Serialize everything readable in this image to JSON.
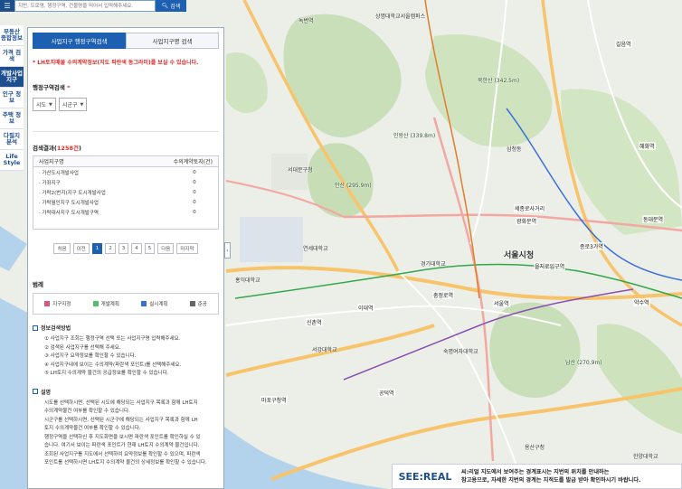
{
  "search": {
    "placeholder": "지번, 도로명, 행정구역, 건물명을 띄어서 입력해주세요.",
    "button_label": "검색"
  },
  "leftnav": {
    "items": [
      {
        "label": "부동산 종합정보",
        "active": false
      },
      {
        "label": "가격 검색",
        "active": false
      },
      {
        "label": "개발사업 지구",
        "active": true
      },
      {
        "label": "인구 정보",
        "active": false
      },
      {
        "label": "주택 정보",
        "active": false
      },
      {
        "label": "다필지 분석",
        "active": false
      },
      {
        "label": "Life Style",
        "active": false
      }
    ]
  },
  "panel": {
    "tabs": [
      {
        "label": "사업지구 행정구역검색",
        "active": true
      },
      {
        "label": "사업지구명 검색",
        "active": false
      }
    ],
    "notice": "* LH토지매물 수의계약정보(지도 파란색 동그라미)를 보실 수 있습니다.",
    "region_title": "행정구역검색",
    "region_required": "*",
    "select_sido": "시도",
    "select_sigungu": "시군구",
    "results_title_prefix": "검색결과(",
    "results_count": "1258건",
    "results_title_suffix": ")",
    "table_headers": {
      "name": "사업지구명",
      "count": "수의계약토지(건)"
    },
    "rows": [
      {
        "name": "· 가산도시개발사업",
        "count": "0"
      },
      {
        "name": "· 가좌지구",
        "count": "0"
      },
      {
        "name": "· 가락2(번지)지구 도시개발사업",
        "count": "0"
      },
      {
        "name": "· 가락월인지구 도시개발사업",
        "count": "0"
      },
      {
        "name": "· 가락대사지구 도시개발구역",
        "count": "0"
      }
    ],
    "pager": {
      "first": "처음",
      "prev": "이전",
      "pages": [
        "1",
        "2",
        "3",
        "4",
        "5"
      ],
      "current": "1",
      "next": "다음",
      "last": "마지막"
    },
    "legend_title": "범례",
    "legend": [
      {
        "label": "지구지정",
        "color": "#e0527f"
      },
      {
        "label": "개발계획",
        "color": "#4fbf6a"
      },
      {
        "label": "실시계획",
        "color": "#3a6fd8"
      },
      {
        "label": "준공",
        "color": "#666666"
      }
    ],
    "guide_title": "정보검색방법",
    "guide_steps": [
      "① 사업지구 조회는 행정구역 선택 또는 사업지구명 입력해주세요.",
      "② 검색된 사업지구를 선택해 주세요.",
      "③ 사업지구 요약정보를 확인할 수 있습니다.",
      "④ 사업지구내에 보이는 수의계약(파란색 포인트)를 선택해주세요.",
      "⑤ LH토지 수의계약 물건의 공급정보를 확인할 수 있습니다."
    ],
    "desc_title": "설명",
    "desc_lines": [
      "시도를 선택하시면, 선택된 시도에 해당되는 사업지구 목록과 함께 LH토지",
      "수의계약물건 여부를 확인할 수 있습니다.",
      "시군구를 선택하시면, 선택된 시군구에 해당되는 사업지구 목록과 함께 LH",
      "토지 수의계약물건 여부를 확인할 수 있습니다.",
      "행정구역을 선택하신 후 지도화면을 보시면 파란색 포인트를 확인하실 수 있",
      "습니다. 여기서 보이는 파란색 포인트가 현재 LH토지 수의계약 물건입니다.",
      "조회된 사업지구를 지도에서 선택하여 요약정보를 확인할 수 있으며, 파란색",
      "포인트를 선택하시면 LH토지 수의계약 물건의 상세정보를 확인할 수 있습니다."
    ]
  },
  "map": {
    "labels": [
      {
        "text": "서울시청",
        "big": true
      },
      {
        "text": "녹번역"
      },
      {
        "text": "상명대학교서울캠퍼스"
      },
      {
        "text": "북한산 (342.5m)"
      },
      {
        "text": "인왕산 (339.8m)"
      },
      {
        "text": "안산 (295.9m)"
      },
      {
        "text": "남산 (270.9m)"
      },
      {
        "text": "서대문구청"
      },
      {
        "text": "연세대학교"
      },
      {
        "text": "서강대학교"
      },
      {
        "text": "홍익대학교"
      },
      {
        "text": "경기대학교"
      },
      {
        "text": "숙명여자대학교"
      },
      {
        "text": "세종로사거리"
      },
      {
        "text": "서울역"
      },
      {
        "text": "충정로역"
      },
      {
        "text": "광화문역"
      },
      {
        "text": "종로3가역"
      },
      {
        "text": "동대문역"
      },
      {
        "text": "을지로입구역"
      },
      {
        "text": "신촌역"
      },
      {
        "text": "이대역"
      },
      {
        "text": "공덕역"
      },
      {
        "text": "마포구청역"
      },
      {
        "text": "삼청동"
      },
      {
        "text": "길음역"
      },
      {
        "text": "혜화역"
      },
      {
        "text": "한양대학교"
      },
      {
        "text": "용산구청"
      },
      {
        "text": "약수역"
      }
    ]
  },
  "banner": {
    "logo": "SEE:REAL",
    "line1": "씨:리얼 지도에서 보여주는 경계표시는 지번의 위치를 안내하는",
    "line2": "참고용으로, 자세한 지번의 경계는 지적도를 발급 받아 확인하시기 바랍니다."
  }
}
